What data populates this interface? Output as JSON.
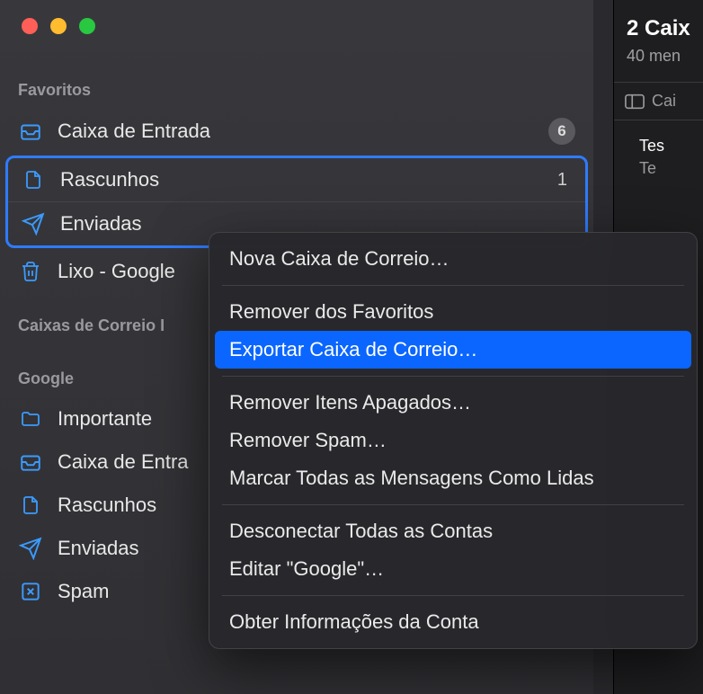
{
  "sidebar": {
    "sections": {
      "favorites": {
        "title": "Favoritos",
        "items": [
          {
            "label": "Caixa de Entrada",
            "badge": "6"
          },
          {
            "label": "Rascunhos",
            "count": "1"
          },
          {
            "label": "Enviadas"
          },
          {
            "label": "Lixo - Google"
          }
        ]
      },
      "smart": {
        "title": "Caixas de Correio I"
      },
      "google": {
        "title": "Google",
        "items": [
          {
            "label": "Importante"
          },
          {
            "label": "Caixa de Entra"
          },
          {
            "label": "Rascunhos"
          },
          {
            "label": "Enviadas"
          },
          {
            "label": "Spam"
          }
        ]
      }
    }
  },
  "context_menu": {
    "items": [
      {
        "label": "Nova Caixa de Correio…"
      },
      {
        "sep": true
      },
      {
        "label": "Remover dos Favoritos"
      },
      {
        "label": "Exportar Caixa de Correio…",
        "highlighted": true
      },
      {
        "sep": true
      },
      {
        "label": "Remover Itens Apagados…"
      },
      {
        "label": "Remover Spam…"
      },
      {
        "label": "Marcar Todas as Mensagens Como Lidas"
      },
      {
        "sep": true
      },
      {
        "label": "Desconectar Todas as Contas"
      },
      {
        "label": "Editar \"Google\"…"
      },
      {
        "sep": true
      },
      {
        "label": "Obter Informações da Conta"
      }
    ]
  },
  "right": {
    "title": "2 Caix",
    "subtitle": "40 men",
    "toolbar_label": "Cai",
    "msg1": "Tes",
    "msg2": "Te"
  }
}
